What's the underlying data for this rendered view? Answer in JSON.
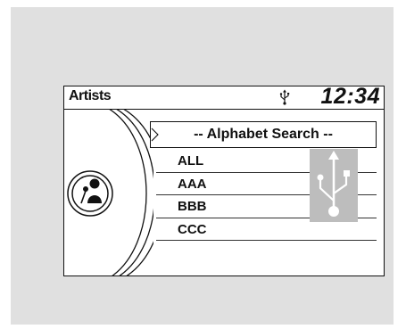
{
  "header": {
    "title": "Artists",
    "clock": "12:34"
  },
  "search": {
    "label": "-- Alphabet Search --"
  },
  "list": {
    "items": [
      {
        "label": "ALL"
      },
      {
        "label": "AAA"
      },
      {
        "label": "BBB"
      },
      {
        "label": "CCC"
      }
    ]
  },
  "icons": {
    "source": "usb-icon",
    "category": "artist-icon",
    "selected": "caret-right-icon",
    "watermark": "usb-large-icon"
  },
  "colors": {
    "frame": "#e0e0e0",
    "screen": "#ffffff",
    "ink": "#111111",
    "usb_panel": "#bdbdbd"
  }
}
